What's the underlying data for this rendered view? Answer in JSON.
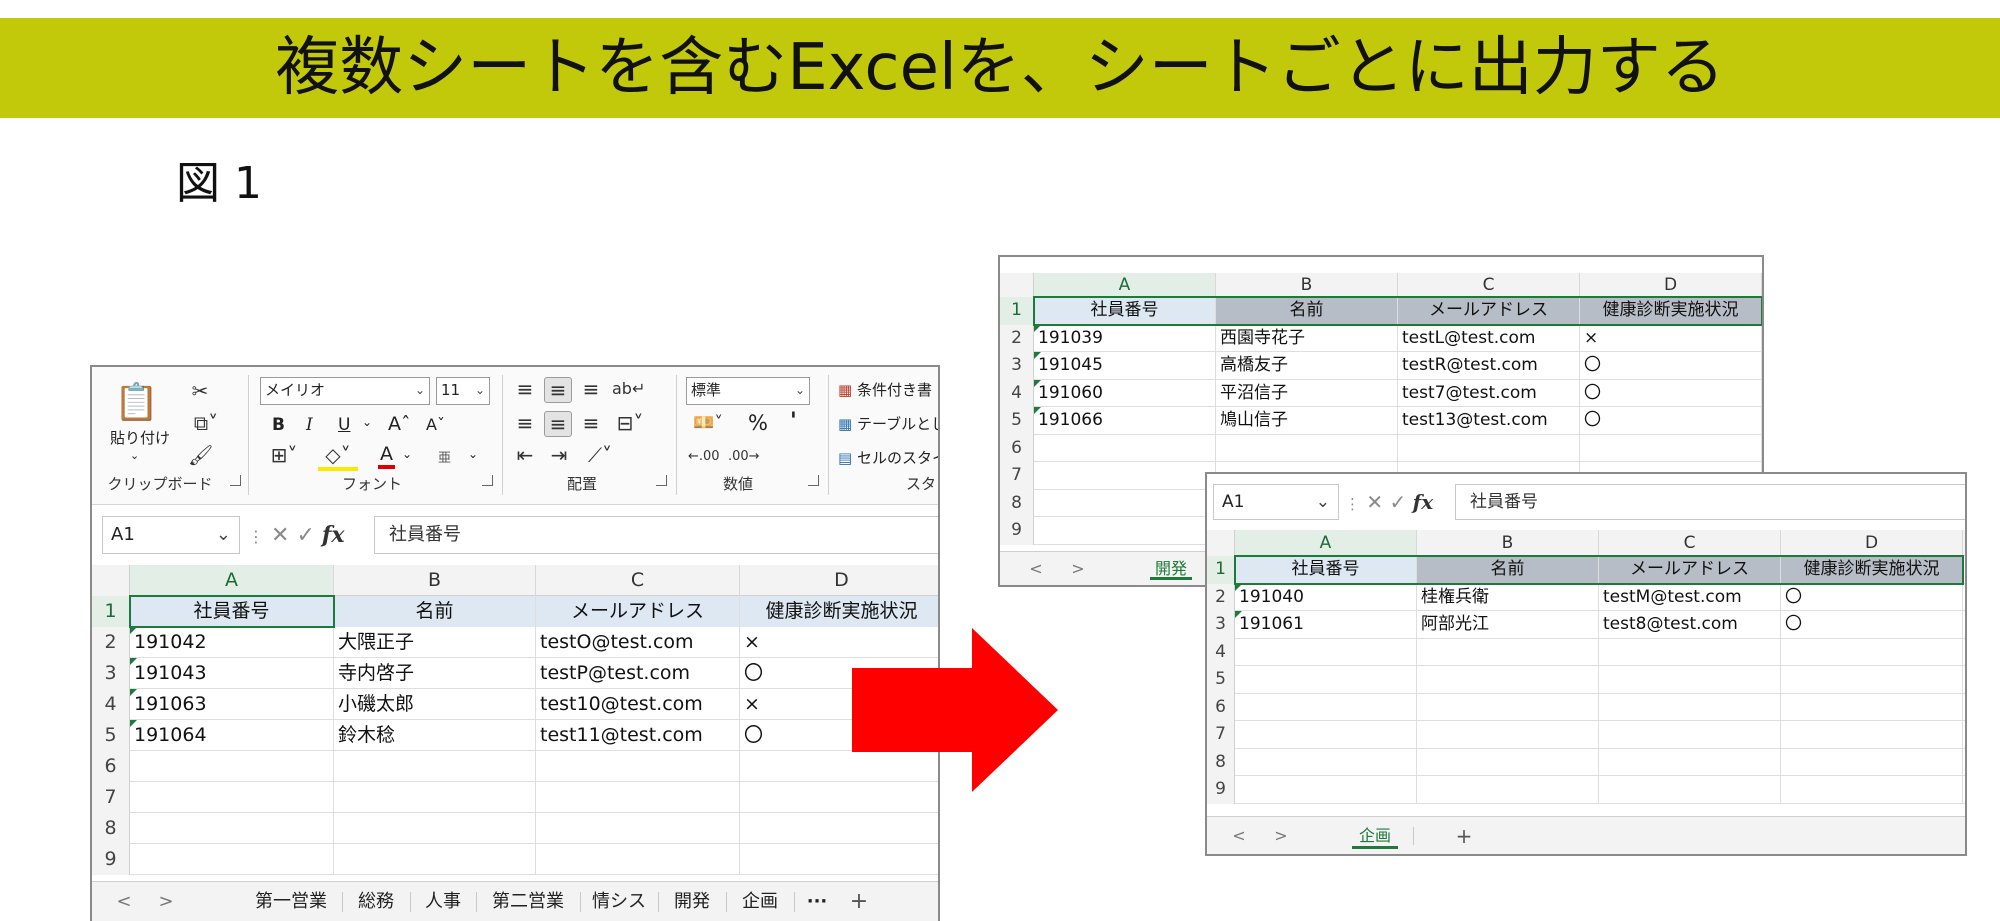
{
  "title": "複数シートを含むExcelを、シートごとに出力する",
  "figure_label": "図 1",
  "colors": {
    "banner": "#c2c90b",
    "arrow": "#ff0000",
    "excel_green": "#1e7a3a",
    "header_fill": "#dde8f3",
    "header_gray": "#b7bdc6"
  },
  "arrow_icon": "right-arrow-icon",
  "left_window": {
    "ribbon": {
      "paste_label": "貼り付け",
      "font_name": "メイリオ",
      "font_size": "11",
      "bold": "B",
      "italic": "I",
      "underline": "U",
      "grow_font": "Aˆ",
      "shrink_font": "Aˇ",
      "font_color": "A",
      "phonetic": "亜",
      "number_format": "標準",
      "percent": "%",
      "comma": "'",
      "cond_format": "条件付き書",
      "format_table": "テーブルとし",
      "cell_styles": "セルのスタイ",
      "groups": {
        "clipboard": "クリップボード",
        "font": "フォント",
        "alignment": "配置",
        "number": "数値",
        "styles": "スタ"
      }
    },
    "name_box": "A1",
    "formula": "社員番号",
    "columns": [
      "A",
      "B",
      "C",
      "D"
    ],
    "rows": [
      [
        "社員番号",
        "名前",
        "メールアドレス",
        "健康診断実施状況"
      ],
      [
        "191042",
        "大隈正子",
        "testO@test.com",
        "×"
      ],
      [
        "191043",
        "寺内啓子",
        "testP@test.com",
        "〇"
      ],
      [
        "191063",
        "小磯太郎",
        "test10@test.com",
        "×"
      ],
      [
        "191064",
        "鈴木稔",
        "test11@test.com",
        "〇"
      ],
      [
        "",
        "",
        "",
        ""
      ],
      [
        "",
        "",
        "",
        ""
      ],
      [
        "",
        "",
        "",
        ""
      ],
      [
        "",
        "",
        "",
        ""
      ]
    ],
    "row_numbers": [
      "1",
      "2",
      "3",
      "4",
      "5",
      "6",
      "7",
      "8",
      "9"
    ],
    "tabs": [
      "第一営業",
      "総務",
      "人事",
      "第二営業",
      "情シス",
      "開発",
      "企画"
    ],
    "more_tabs": "···",
    "add_sheet": "+",
    "nav_prev": "<",
    "nav_next": ">"
  },
  "top_right_window": {
    "columns": [
      "A",
      "B",
      "C",
      "D"
    ],
    "rows": [
      [
        "社員番号",
        "名前",
        "メールアドレス",
        "健康診断実施状況"
      ],
      [
        "191039",
        "西園寺花子",
        "testL@test.com",
        "×"
      ],
      [
        "191045",
        "高橋友子",
        "testR@test.com",
        "〇"
      ],
      [
        "191060",
        "平沼信子",
        "test7@test.com",
        "〇"
      ],
      [
        "191066",
        "鳩山信子",
        "test13@test.com",
        "〇"
      ],
      [
        "",
        "",
        "",
        ""
      ],
      [
        "",
        "",
        "",
        ""
      ],
      [
        "",
        "",
        "",
        ""
      ],
      [
        "",
        "",
        "",
        ""
      ]
    ],
    "row_numbers": [
      "1",
      "2",
      "3",
      "4",
      "5",
      "6",
      "7",
      "8",
      "9"
    ],
    "tabs": [
      "開発"
    ],
    "nav_prev": "<",
    "nav_next": ">"
  },
  "bottom_right_window": {
    "name_box": "A1",
    "formula": "社員番号",
    "columns": [
      "A",
      "B",
      "C",
      "D"
    ],
    "rows": [
      [
        "社員番号",
        "名前",
        "メールアドレス",
        "健康診断実施状況"
      ],
      [
        "191040",
        "桂権兵衛",
        "testM@test.com",
        "〇"
      ],
      [
        "191061",
        "阿部光江",
        "test8@test.com",
        "〇"
      ],
      [
        "",
        "",
        "",
        ""
      ],
      [
        "",
        "",
        "",
        ""
      ],
      [
        "",
        "",
        "",
        ""
      ],
      [
        "",
        "",
        "",
        ""
      ],
      [
        "",
        "",
        "",
        ""
      ],
      [
        "",
        "",
        "",
        ""
      ]
    ],
    "row_numbers": [
      "1",
      "2",
      "3",
      "4",
      "5",
      "6",
      "7",
      "8",
      "9"
    ],
    "tabs": [
      "企画"
    ],
    "add_sheet": "+",
    "nav_prev": "<",
    "nav_next": ">"
  }
}
